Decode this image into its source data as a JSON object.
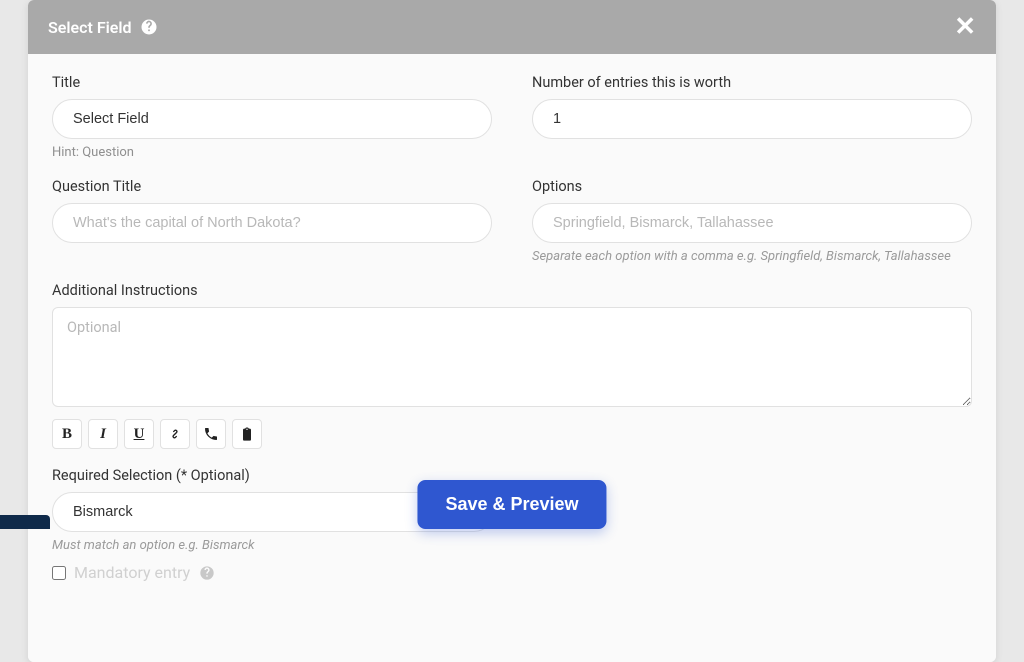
{
  "header": {
    "title": "Select Field"
  },
  "title_field": {
    "label": "Title",
    "value": "Select Field",
    "hint": "Hint: Question"
  },
  "entries": {
    "label": "Number of entries this is worth",
    "value": "1"
  },
  "question": {
    "label": "Question Title",
    "placeholder": "What's the capital of North Dakota?",
    "value": ""
  },
  "options": {
    "label": "Options",
    "placeholder": "Springfield, Bismarck, Tallahassee",
    "value": "",
    "hint": "Separate each option with a comma e.g. Springfield, Bismarck, Tallahassee"
  },
  "instructions": {
    "label": "Additional Instructions",
    "placeholder": "Optional",
    "value": ""
  },
  "required": {
    "label": "Required Selection (* Optional)",
    "value": "Bismarck",
    "hint": "Must match an option e.g. Bismarck"
  },
  "mandatory": {
    "label": "Mandatory entry"
  },
  "save_label": "Save & Preview"
}
